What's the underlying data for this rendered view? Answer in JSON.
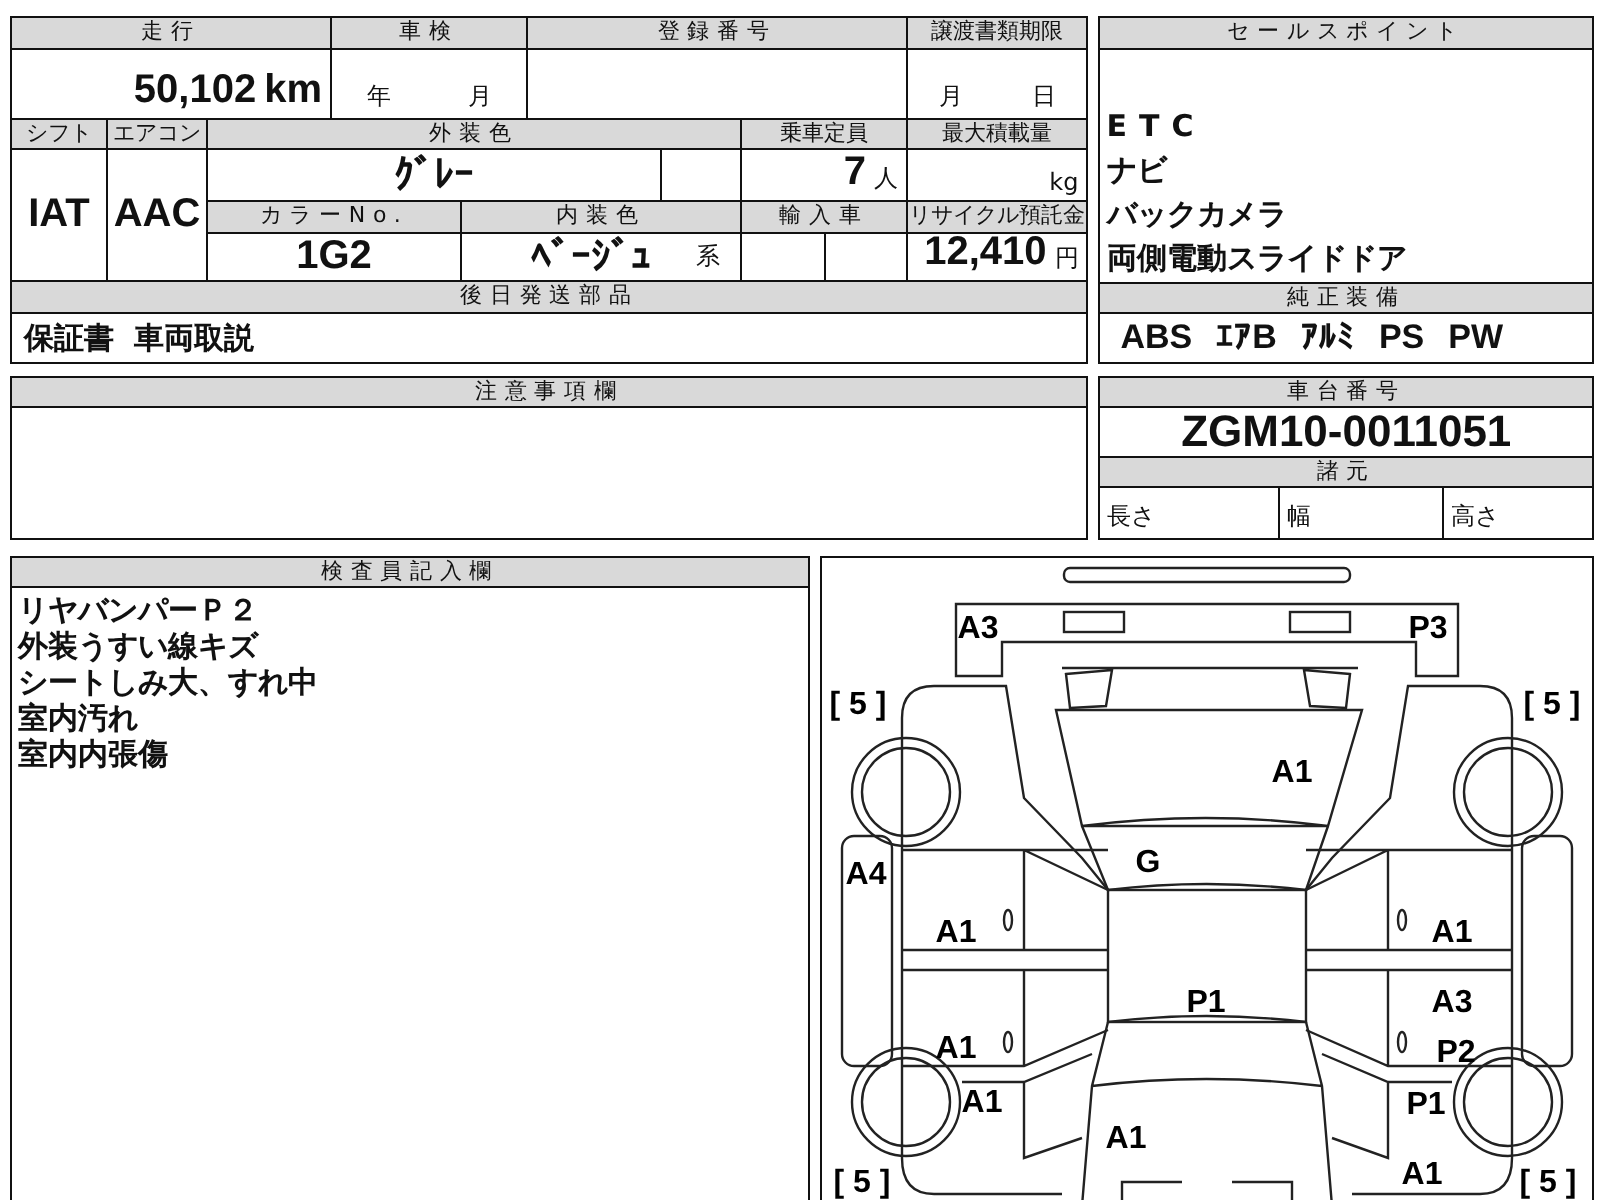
{
  "vehicle_table": {
    "mileage": {
      "label": "走行",
      "value": "50,102",
      "unit": "km"
    },
    "inspection": {
      "label": "車検",
      "year_unit": "年",
      "month_unit": "月"
    },
    "registration_number": {
      "label": "登録番号"
    },
    "transfer_deadline": {
      "label": "譲渡書類期限",
      "month_unit": "月",
      "day_unit": "日"
    },
    "shift": {
      "label": "シフト",
      "value": "IAT"
    },
    "air_conditioner": {
      "label": "エアコン",
      "value": "AAC"
    },
    "exterior_color": {
      "label": "外装色",
      "value": "ｸﾞﾚｰ"
    },
    "capacity": {
      "label": "乗車定員",
      "value": "7",
      "unit": "人"
    },
    "max_load": {
      "label": "最大積載量",
      "unit": "kg"
    },
    "color_number": {
      "label": "カラーNo.",
      "value": "1G2"
    },
    "interior_color": {
      "label": "内装色",
      "value": "ﾍﾞｰｼﾞｭ",
      "suffix": "系"
    },
    "imported": {
      "label": "輸入車"
    },
    "recycling_deposit": {
      "label": "リサイクル預託金",
      "value": "12,410",
      "unit": "円"
    },
    "later_parts": {
      "label": "後日発送部品",
      "items": [
        "保証書",
        "車両取説"
      ]
    }
  },
  "sales_points": {
    "title": "セールスポイント",
    "items": [
      "ETC",
      "ナビ",
      "バックカメラ",
      "両側電動スライドドア"
    ]
  },
  "standard_equipment": {
    "title": "純正装備",
    "items": [
      "ABS",
      "ｴｱB",
      "ｱﾙﾐ",
      "PS",
      "PW"
    ]
  },
  "notes": {
    "title": "注意事項欄"
  },
  "chassis": {
    "title": "車台番号",
    "value": "ZGM10-0011051"
  },
  "specs": {
    "title": "諸元",
    "fields": [
      "長さ",
      "幅",
      "高さ"
    ]
  },
  "inspector": {
    "title": "検査員記入欄",
    "lines": [
      "リヤバンパーＰ２",
      "外装うすい線キズ",
      "シートしみ大、すれ中",
      "室内汚れ",
      "室内内張傷"
    ]
  },
  "diagram": {
    "marks": [
      {
        "text": "A3"
      },
      {
        "text": "P3"
      },
      {
        "text": "[ 5 ]"
      },
      {
        "text": "[ 5 ]"
      },
      {
        "text": "A1"
      },
      {
        "text": "G"
      },
      {
        "text": "A4"
      },
      {
        "text": "A1"
      },
      {
        "text": "A1"
      },
      {
        "text": "P1"
      },
      {
        "text": "A3"
      },
      {
        "text": "A1"
      },
      {
        "text": "P2"
      },
      {
        "text": "A1"
      },
      {
        "text": "P1"
      },
      {
        "text": "A1"
      },
      {
        "text": "[ 5 ]"
      },
      {
        "text": "A1"
      },
      {
        "text": "[ 5 ]"
      }
    ]
  }
}
